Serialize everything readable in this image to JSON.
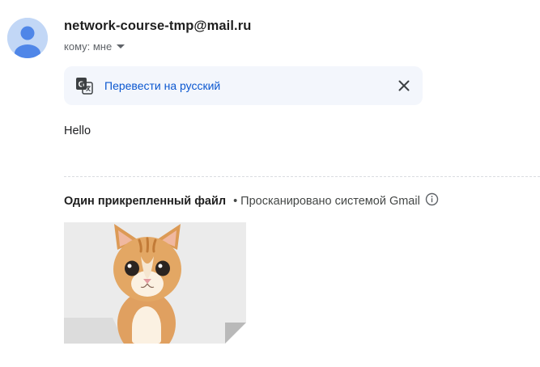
{
  "message": {
    "sender": "network-course-tmp@mail.ru",
    "recipient_label": "кому: мне",
    "body": "Hello"
  },
  "translate": {
    "link_label": "Перевести на русский"
  },
  "attachments": {
    "title": "Один прикрепленный файл",
    "separator": "•",
    "scan_label": "Просканировано системой Gmail"
  },
  "icons": {
    "avatar": "person-avatar-icon",
    "caret": "caret-down-icon",
    "translate": "translate-icon",
    "close": "close-icon",
    "info": "info-icon"
  },
  "colors": {
    "link": "#0b57d0",
    "translate_bar_bg": "#f3f6fc",
    "avatar_bg": "#c2d7f6",
    "avatar_fg": "#5f8fe6"
  }
}
